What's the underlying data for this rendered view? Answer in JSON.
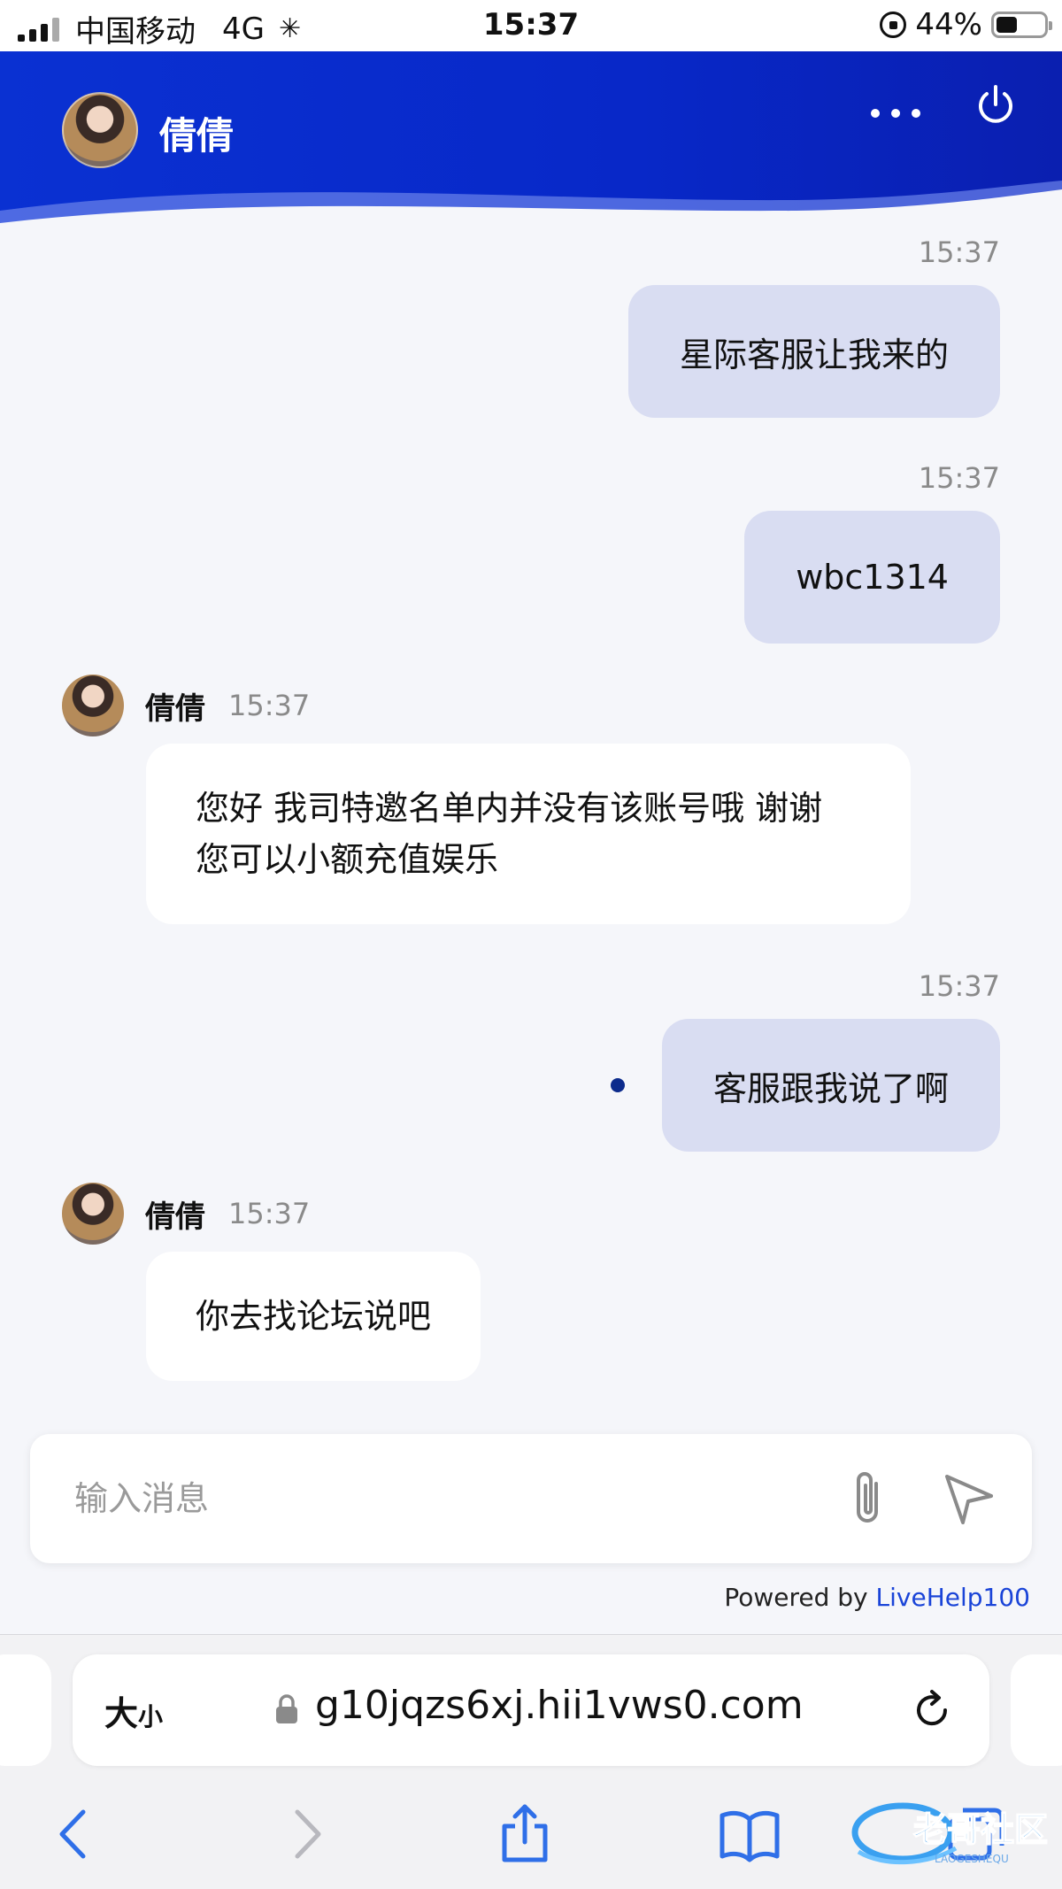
{
  "status_bar": {
    "carrier": "中国移动",
    "network": "4G",
    "time": "15:37",
    "battery": "44%",
    "battery_level": 0.44
  },
  "header": {
    "agent_name": "倩倩",
    "colors": {
      "gradient_start": "#0a31d2",
      "gradient_end": "#0a1fb0"
    }
  },
  "messages": [
    {
      "side": "right",
      "time": "15:37",
      "text": "星际客服让我来的"
    },
    {
      "side": "right",
      "time": "15:37",
      "text": "wbc1314"
    },
    {
      "side": "left",
      "sender": "倩倩",
      "time": "15:37",
      "text": "您好 我司特邀名单内并没有该账号哦 谢谢 您可以小额充值娱乐"
    },
    {
      "side": "right",
      "time": "15:37",
      "text": "客服跟我说了啊",
      "unread_dot": true
    },
    {
      "side": "left",
      "sender": "倩倩",
      "time": "15:37",
      "text": "你去找论坛说吧"
    }
  ],
  "composer": {
    "placeholder": "输入消息"
  },
  "footer": {
    "powered_prefix": "Powered by",
    "powered_link": "LiveHelp100"
  },
  "browser": {
    "text_size_label": "大",
    "text_size_small": "小",
    "url": "g10jqzs6xj.hii1vws0.com"
  },
  "watermark": {
    "text": "老哥社区",
    "subtext": "LAOGESHEQU"
  }
}
